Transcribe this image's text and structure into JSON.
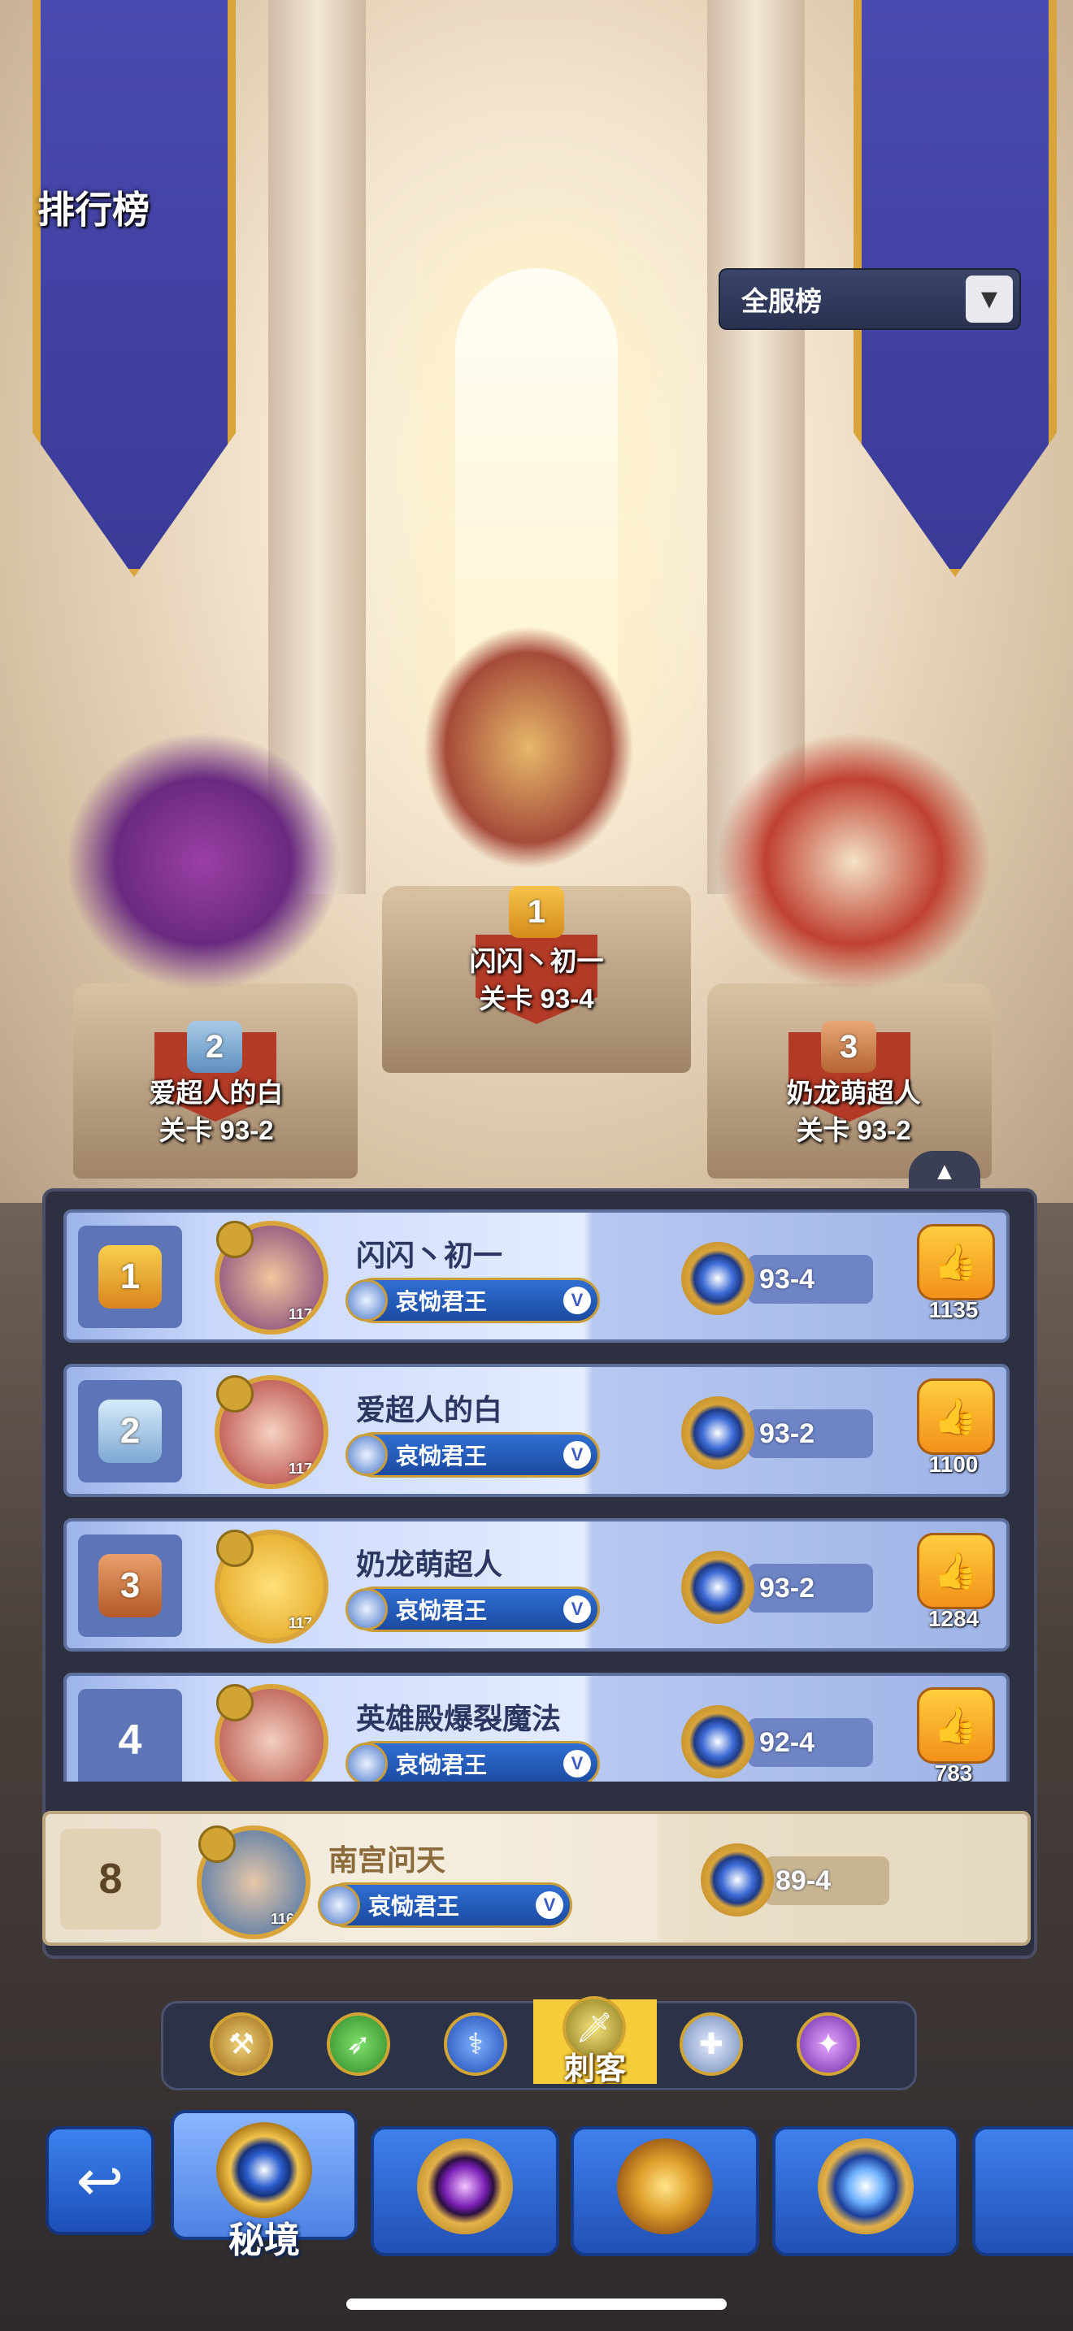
{
  "header": {
    "title": "排行榜",
    "server_dropdown": {
      "selected": "全服榜",
      "arrow_icon": "triangle-down-icon"
    }
  },
  "podium": [
    {
      "rank": "1",
      "name": "闪闪丶初一",
      "stage": "关卡 93-4"
    },
    {
      "rank": "2",
      "name": "爱超人的白",
      "stage": "关卡 93-2"
    },
    {
      "rank": "3",
      "name": "奶龙萌超人",
      "stage": "关卡 93-2"
    }
  ],
  "ranking": {
    "collapse_icon": "triangle-up-icon",
    "rows": [
      {
        "rank": "1",
        "name": "闪闪丶初一",
        "level": "117",
        "title": "哀恸君王",
        "title_tier": "V",
        "stage": "93-4",
        "likes": "1135"
      },
      {
        "rank": "2",
        "name": "爱超人的白",
        "level": "117",
        "title": "哀恸君王",
        "title_tier": "V",
        "stage": "93-2",
        "likes": "1100"
      },
      {
        "rank": "3",
        "name": "奶龙萌超人",
        "level": "117",
        "title": "哀恸君王",
        "title_tier": "V",
        "stage": "93-2",
        "likes": "1284"
      },
      {
        "rank": "4",
        "name": "英雄殿爆裂魔法",
        "level": "",
        "title": "哀恸君王",
        "title_tier": "V",
        "stage": "92-4",
        "likes": "783"
      }
    ],
    "my_row": {
      "rank": "8",
      "name": "南宫问天",
      "level": "116",
      "title": "哀恸君王",
      "title_tier": "V",
      "stage": "89-4"
    }
  },
  "class_filter": {
    "active_label": "刺客",
    "buttons": [
      "warrior-axe-icon",
      "archer-bow-icon",
      "mage-staff-icon",
      "assassin-dagger-icon",
      "priest-cross-icon",
      "summoner-spirit-icon"
    ]
  },
  "bottom_nav": {
    "back_icon": "return-arrow-icon",
    "tabs": [
      {
        "label": "秘境",
        "icon": "secret-realm-emblem-icon",
        "active": true
      },
      {
        "label": "",
        "icon": "purple-eye-emblem-icon",
        "active": false
      },
      {
        "label": "",
        "icon": "crown-emblem-icon",
        "active": false
      },
      {
        "label": "",
        "icon": "star-compass-emblem-icon",
        "active": false
      }
    ]
  },
  "colors": {
    "accent_gold": "#d1a433",
    "row_blue": "#c8d7fb",
    "my_row_beige": "#f5eedf",
    "nav_blue": "#2150b5"
  }
}
